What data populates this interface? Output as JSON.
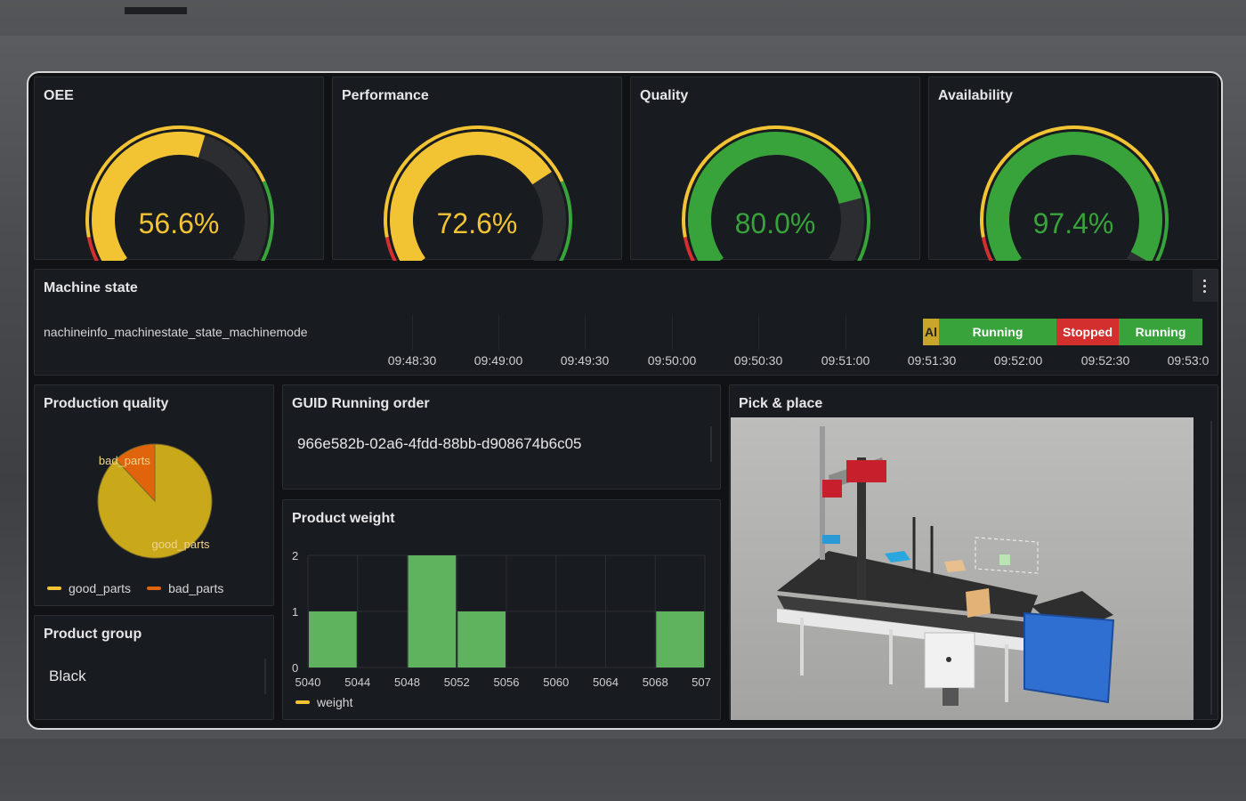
{
  "colors": {
    "green": "#37a33a",
    "yellow": "#f2c433",
    "red": "#d32f2f",
    "orange": "#e0640c",
    "track": "#2b2d31"
  },
  "gauges": [
    {
      "title": "OEE",
      "value": 56.6,
      "label": "56.6%",
      "color": "#f2c433"
    },
    {
      "title": "Performance",
      "value": 72.6,
      "label": "72.6%",
      "color": "#f2c433"
    },
    {
      "title": "Quality",
      "value": 80.0,
      "label": "80.0%",
      "color": "#37a33a"
    },
    {
      "title": "Availability",
      "value": 97.4,
      "label": "97.4%",
      "color": "#37a33a"
    }
  ],
  "machine_state": {
    "title": "Machine state",
    "series_label": "nachineinfo_machinestate_state_machinemode",
    "segments": [
      {
        "label": "Al",
        "color": "#c8a62a"
      },
      {
        "label": "Running",
        "color": "#37a33a"
      },
      {
        "label": "Stopped",
        "color": "#d32f2f"
      },
      {
        "label": "Running",
        "color": "#37a33a"
      }
    ],
    "ticks": [
      "09:48:30",
      "09:49:00",
      "09:49:30",
      "09:50:00",
      "09:50:30",
      "09:51:00",
      "09:51:30",
      "09:52:00",
      "09:52:30",
      "09:53:0"
    ]
  },
  "production_quality": {
    "title": "Production quality",
    "chart_data": {
      "type": "pie",
      "slices": [
        {
          "name": "good_parts",
          "value": 88,
          "color": "#c9a81a"
        },
        {
          "name": "bad_parts",
          "value": 12,
          "color": "#e0640c"
        }
      ],
      "legend": "bottom"
    },
    "legend": [
      {
        "name": "good_parts",
        "color": "#f2c433"
      },
      {
        "name": "bad_parts",
        "color": "#e0640c"
      }
    ]
  },
  "guid": {
    "title": "GUID Running order",
    "value": "966e582b-02a6-4fdd-88bb-d908674b6c05"
  },
  "product_group": {
    "title": "Product group",
    "value": "Black"
  },
  "product_weight": {
    "title": "Product weight",
    "chart_data": {
      "type": "bar",
      "x_ticks": [
        "5040",
        "5044",
        "5048",
        "5052",
        "5056",
        "5060",
        "5064",
        "5068",
        "507"
      ],
      "bins": [
        {
          "x0": 5040,
          "x1": 5044,
          "count": 1
        },
        {
          "x0": 5048,
          "x1": 5052,
          "count": 2
        },
        {
          "x0": 5052,
          "x1": 5056,
          "count": 1
        },
        {
          "x0": 5068,
          "x1": 5072,
          "count": 1
        }
      ],
      "xlim": [
        5040,
        5072
      ],
      "ylim": [
        0,
        2
      ],
      "y_ticks": [
        "0",
        "1",
        "2"
      ],
      "series_name": "weight",
      "bar_color": "#5fb35f",
      "legend_color": "#f2c433"
    }
  },
  "pick_place": {
    "title": "Pick & place"
  }
}
